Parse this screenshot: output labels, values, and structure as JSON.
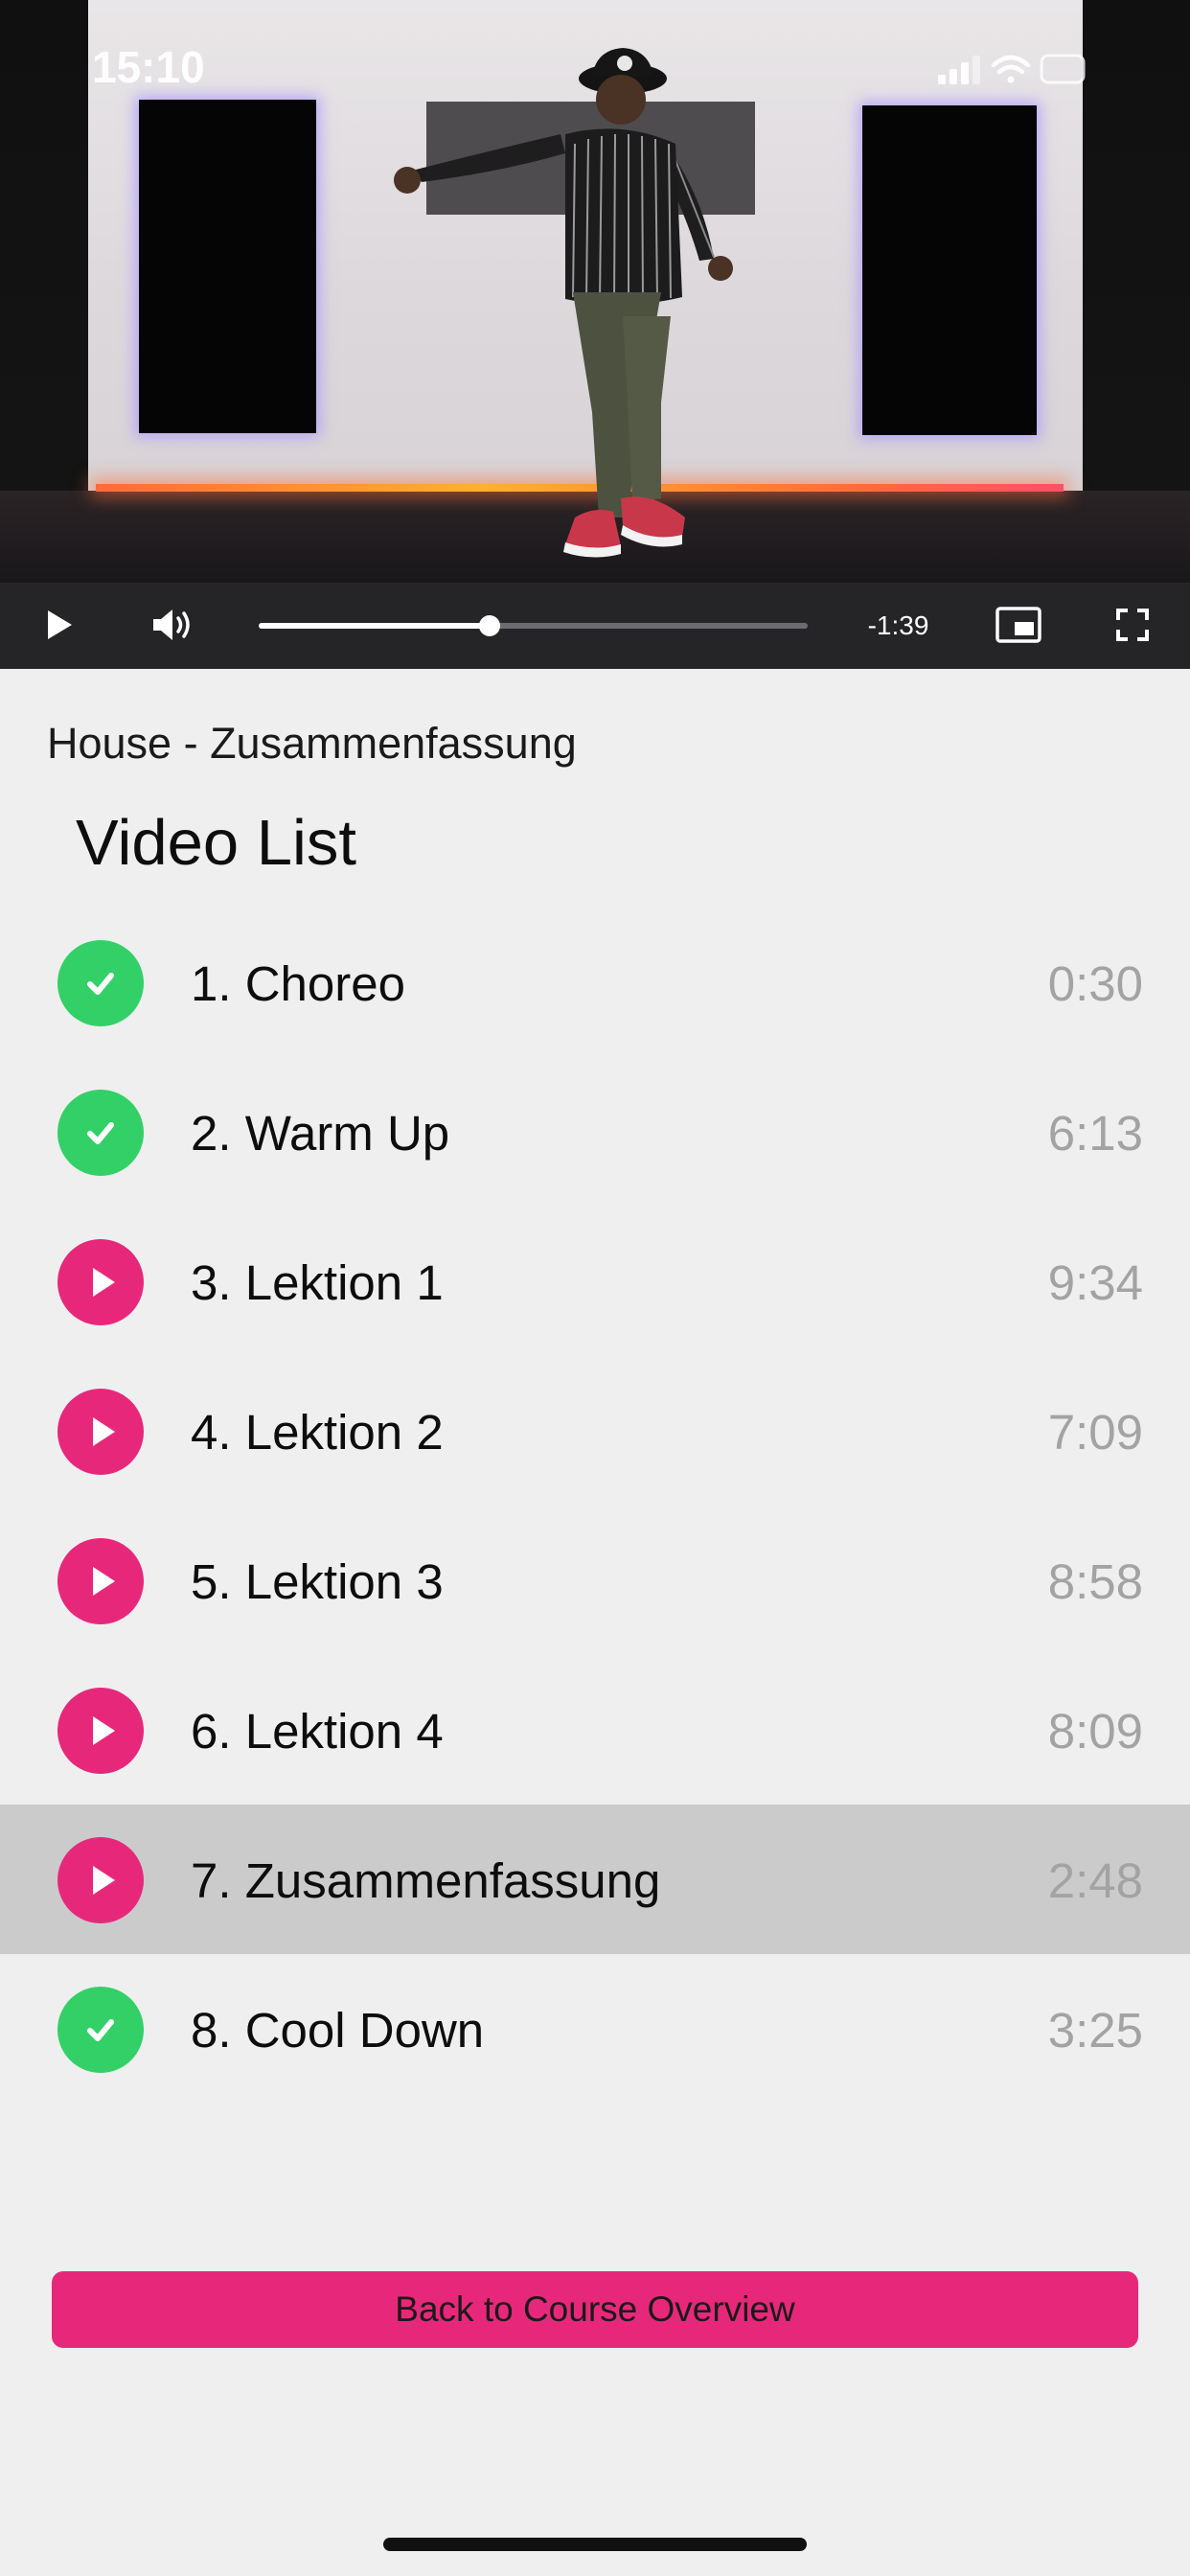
{
  "status_bar": {
    "time": "15:10",
    "icons": [
      "cellular-signal-icon",
      "wifi-icon",
      "battery-icon"
    ]
  },
  "player": {
    "remaining_time": "-1:39",
    "progress": 0.42,
    "controls": [
      "play-icon",
      "volume-icon",
      "picture-in-picture-icon",
      "fullscreen-icon"
    ]
  },
  "course": {
    "title": "House - Zusammenfassung"
  },
  "video_list": {
    "heading": "Video List",
    "items": [
      {
        "title": "1. Choreo",
        "duration": "0:30",
        "status": "done",
        "active": false
      },
      {
        "title": "2. Warm Up",
        "duration": "6:13",
        "status": "done",
        "active": false
      },
      {
        "title": "3. Lektion 1",
        "duration": "9:34",
        "status": "todo",
        "active": false
      },
      {
        "title": "4. Lektion 2",
        "duration": "7:09",
        "status": "todo",
        "active": false
      },
      {
        "title": "5. Lektion 3",
        "duration": "8:58",
        "status": "todo",
        "active": false
      },
      {
        "title": "6. Lektion 4",
        "duration": "8:09",
        "status": "todo",
        "active": false
      },
      {
        "title": "7. Zusammenfassung",
        "duration": "2:48",
        "status": "todo",
        "active": true
      },
      {
        "title": "8. Cool Down",
        "duration": "3:25",
        "status": "done",
        "active": false
      }
    ]
  },
  "actions": {
    "back_label": "Back to Course Overview"
  },
  "colors": {
    "accent": "#e7287a",
    "done": "#33d067",
    "duration_text": "#a3a3a3",
    "active_row": "#cbcbcb",
    "background": "#efefef"
  }
}
